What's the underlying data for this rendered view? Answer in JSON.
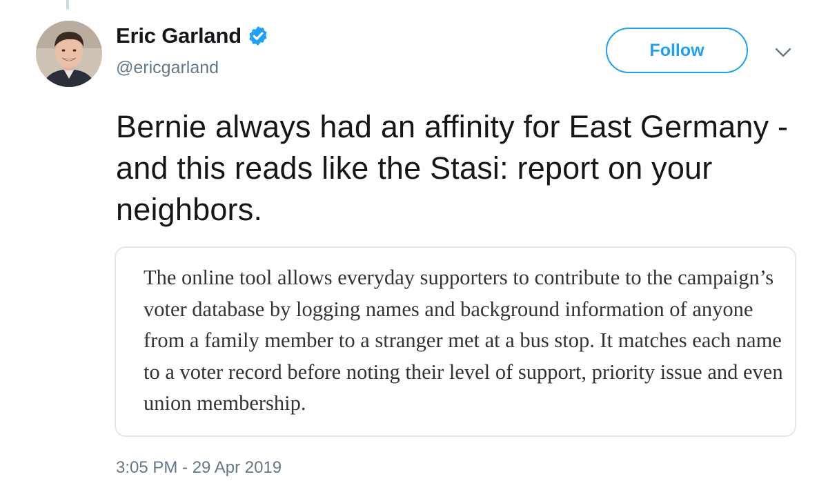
{
  "author": {
    "display_name": "Eric Garland",
    "handle": "@ericgarland",
    "verified": true,
    "verified_icon": "verified-badge-icon"
  },
  "actions": {
    "follow_label": "Follow",
    "more_icon": "chevron-down-icon"
  },
  "tweet": {
    "text": "Bernie always had an affinity for East Germany - and this reads like the Stasi: report on your neighbors.",
    "quote_excerpt": "The online tool allows everyday supporters to contribute to the campaign’s voter database by logging names and background information of anyone from a family member to a stranger met at a bus stop. It matches each name to a voter record before noting their level of support, priority issue and even union membership.",
    "timestamp": "3:05 PM - 29 Apr 2019"
  },
  "colors": {
    "accent": "#1da1f2",
    "text_primary": "#14171a",
    "text_secondary": "#657786",
    "card_border": "#e1e8ed"
  }
}
